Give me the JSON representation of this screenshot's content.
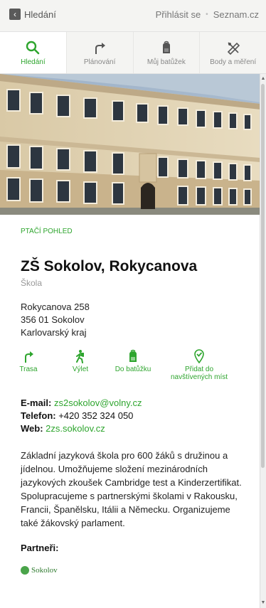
{
  "topbar": {
    "back_label": "Hledání",
    "login_label": "Přihlásit se",
    "brand_label": "Seznam.cz",
    "separator": "•"
  },
  "tabs": [
    {
      "label": "Hledání",
      "icon": "search-icon",
      "active": true
    },
    {
      "label": "Plánování",
      "icon": "route-icon",
      "active": false
    },
    {
      "label": "Můj batůžek",
      "icon": "backpack-icon",
      "active": false
    },
    {
      "label": "Body a měření",
      "icon": "ruler-icon",
      "active": false
    }
  ],
  "place": {
    "aerial_label": "PTAČÍ POHLED",
    "name": "ZŠ Sokolov, Rokycanova",
    "category": "Škola",
    "address": [
      "Rokycanova 258",
      "356 01  Sokolov",
      "Karlovarský kraj"
    ]
  },
  "actions": [
    {
      "label": "Trasa",
      "icon": "route-icon"
    },
    {
      "label": "Výlet",
      "icon": "hiker-icon"
    },
    {
      "label": "Do batůžku",
      "icon": "backpack-icon"
    },
    {
      "label": "Přidat do navštívených míst",
      "icon": "visited-icon"
    }
  ],
  "contacts": {
    "email_label": "E-mail:",
    "email": "zs2sokolov@volny.cz",
    "phone_label": "Telefon:",
    "phone": "+420 352 324 050",
    "web_label": "Web:",
    "web": "2zs.sokolov.cz"
  },
  "description": "Základní jazyková škola pro 600 žáků s družinou a jídelnou. Umožňujeme složení mezinárodních jazykových zkoušek Cambridge test a Kinderzertifikat. Spolupracujeme s partnerskými školami v Rakousku, Francii, Španělsku, Itálii a Německu. Organizujeme také žákovský parlament.",
  "partners": {
    "heading": "Partneři:",
    "logo_text": "Sokolov"
  },
  "colors": {
    "accent": "#2ea52e",
    "background": "#f4f4f2"
  }
}
